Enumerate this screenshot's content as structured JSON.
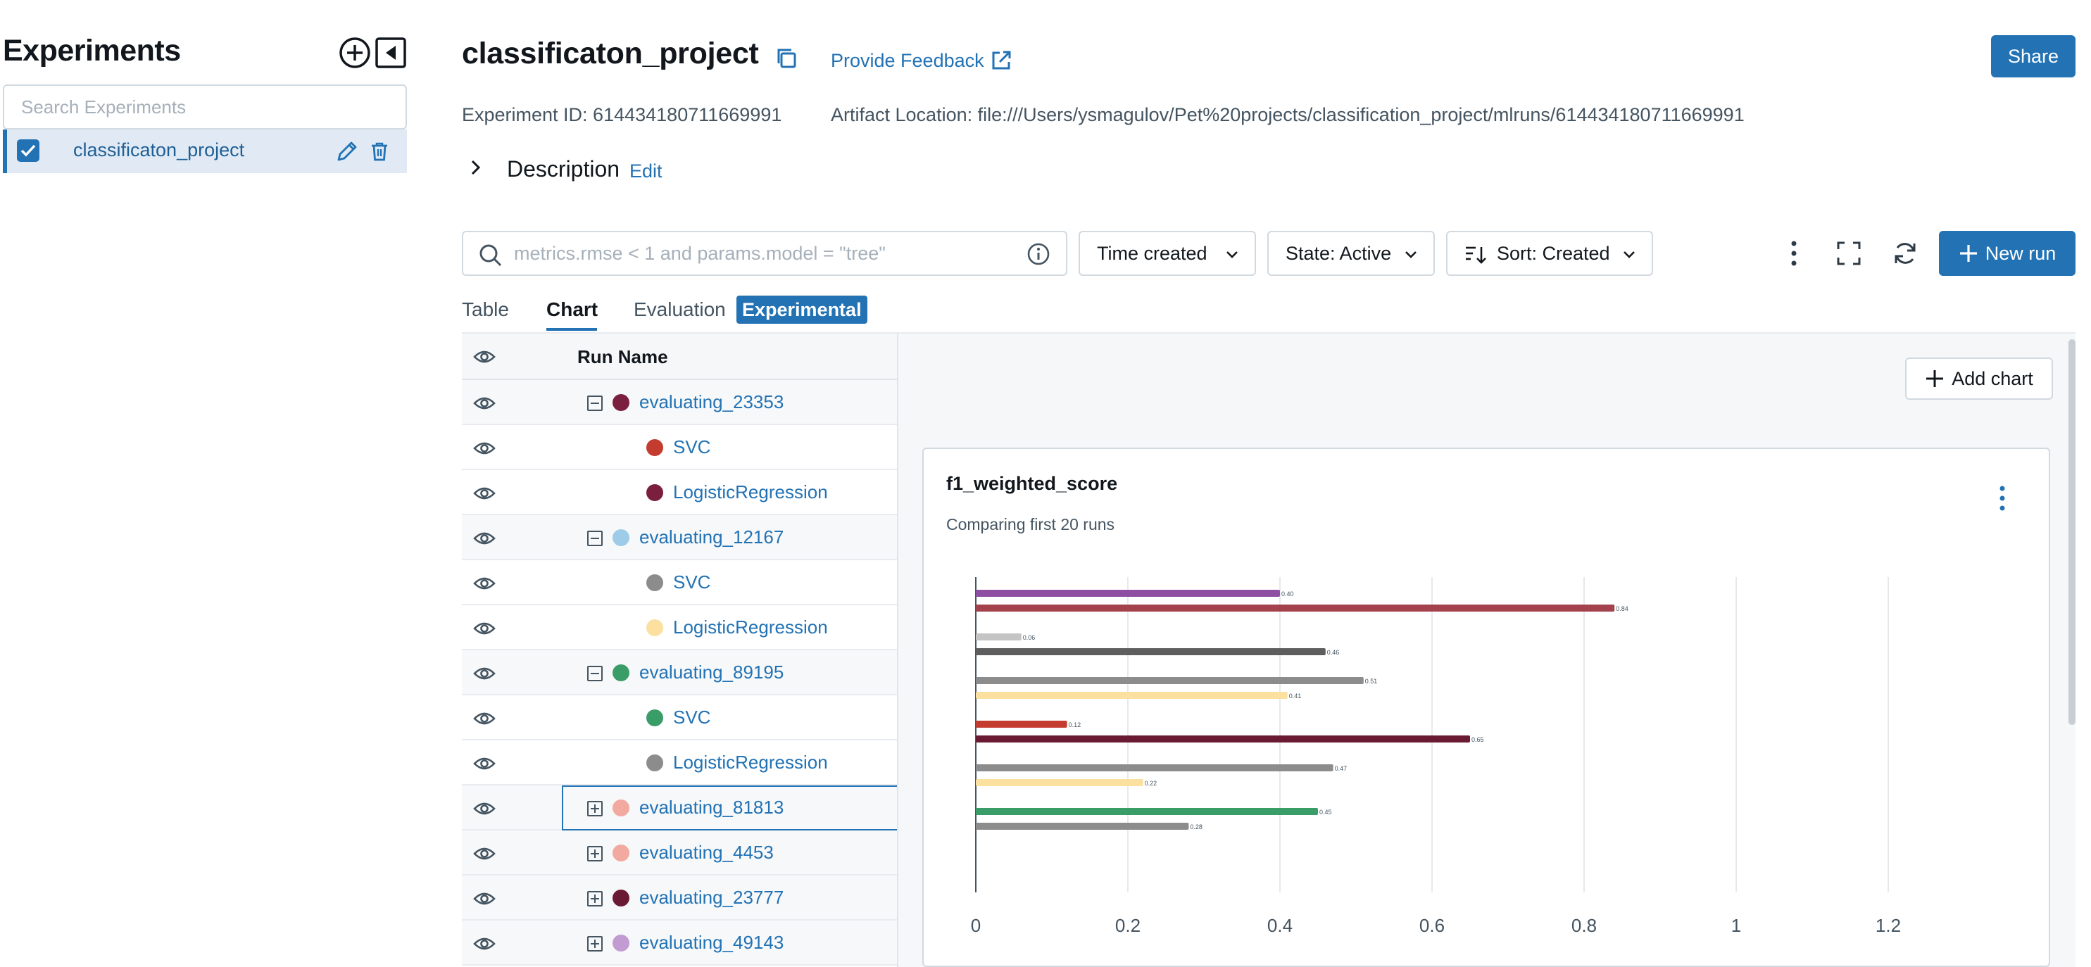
{
  "sidebar": {
    "title": "Experiments",
    "search_placeholder": "Search Experiments",
    "experiments": [
      {
        "name": "classificaton_project",
        "checked": true
      }
    ]
  },
  "header": {
    "title": "classificaton_project",
    "feedback_label": "Provide Feedback",
    "share_label": "Share",
    "experiment_id": "Experiment ID: 614434180711669991",
    "artifact_location": "Artifact Location: file:///Users/ysmagulov/Pet%20projects/classification_project/mlruns/614434180711669991",
    "description_label": "Description",
    "description_edit": "Edit"
  },
  "toolbar": {
    "filter_placeholder": "metrics.rmse < 1 and params.model = \"tree\"",
    "time_created": "Time created",
    "state": "State: Active",
    "sort": "Sort: Created",
    "new_run": "New run"
  },
  "tabs": {
    "table": "Table",
    "chart": "Chart",
    "evaluation": "Evaluation",
    "experimental": "Experimental",
    "active": "Chart"
  },
  "runs": {
    "header": "Run Name",
    "rows": [
      {
        "name": "evaluating_23353",
        "level": 0,
        "toggle": "minus",
        "color": "#7a1f3d"
      },
      {
        "name": "SVC",
        "level": 1,
        "color": "#c43c2f"
      },
      {
        "name": "LogisticRegression",
        "level": 1,
        "color": "#7a1f3d"
      },
      {
        "name": "evaluating_12167",
        "level": 0,
        "toggle": "minus",
        "color": "#9ecbe8"
      },
      {
        "name": "SVC",
        "level": 1,
        "color": "#8c8c8c"
      },
      {
        "name": "LogisticRegression",
        "level": 1,
        "color": "#fbe0a0"
      },
      {
        "name": "evaluating_89195",
        "level": 0,
        "toggle": "minus",
        "color": "#3a9d68"
      },
      {
        "name": "SVC",
        "level": 1,
        "color": "#3a9d68"
      },
      {
        "name": "LogisticRegression",
        "level": 1,
        "color": "#8c8c8c"
      },
      {
        "name": "evaluating_81813",
        "level": 0,
        "toggle": "plus",
        "color": "#f2a9a0",
        "selected": true
      },
      {
        "name": "evaluating_4453",
        "level": 0,
        "toggle": "plus",
        "color": "#f2a9a0"
      },
      {
        "name": "evaluating_23777",
        "level": 0,
        "toggle": "plus",
        "color": "#6b1a33"
      },
      {
        "name": "evaluating_49143",
        "level": 0,
        "toggle": "plus",
        "color": "#c39bd3"
      }
    ]
  },
  "chart_panel": {
    "add_chart_label": "Add chart",
    "card_title": "f1_weighted_score",
    "card_subtitle": "Comparing first 20 runs"
  },
  "chart_data": {
    "type": "bar",
    "orientation": "horizontal",
    "title": "f1_weighted_score",
    "subtitle": "Comparing first 20 runs",
    "xlim": [
      0,
      1.38
    ],
    "x_ticks": [
      "0",
      "0.2",
      "0.4",
      "0.6",
      "0.8",
      "1",
      "1.2"
    ],
    "x_tick_values": [
      0,
      0.2,
      0.4,
      0.6,
      0.8,
      1,
      1.2
    ],
    "grid": true,
    "bars": [
      {
        "value": 0.4,
        "label": "0.40",
        "color": "#8e4fa3",
        "group": 0
      },
      {
        "value": 0.84,
        "label": "0.84",
        "color": "#a3414c",
        "group": 0
      },
      {
        "value": 0.06,
        "label": "0.06",
        "color": "#c4c4c4",
        "group": 1
      },
      {
        "value": 0.46,
        "label": "0.46",
        "color": "#5e5e5e",
        "group": 1
      },
      {
        "value": 0.51,
        "label": "0.51",
        "color": "#8c8c8c",
        "group": 2
      },
      {
        "value": 0.41,
        "label": "0.41",
        "color": "#fbe0a0",
        "group": 2
      },
      {
        "value": 0.12,
        "label": "0.12",
        "color": "#c43c2f",
        "group": 3
      },
      {
        "value": 0.65,
        "label": "0.65",
        "color": "#6b1a33",
        "group": 3
      },
      {
        "value": 0.47,
        "label": "0.47",
        "color": "#8c8c8c",
        "group": 4
      },
      {
        "value": 0.22,
        "label": "0.22",
        "color": "#fbe0a0",
        "group": 4
      },
      {
        "value": 0.45,
        "label": "0.45",
        "color": "#3a9d68",
        "group": 5
      },
      {
        "value": 0.28,
        "label": "0.28",
        "color": "#8c8c8c",
        "group": 5
      }
    ]
  },
  "colors": {
    "accent": "#2272b4",
    "selected_bg": "#e1eaf4",
    "border": "#d1d9e1"
  }
}
